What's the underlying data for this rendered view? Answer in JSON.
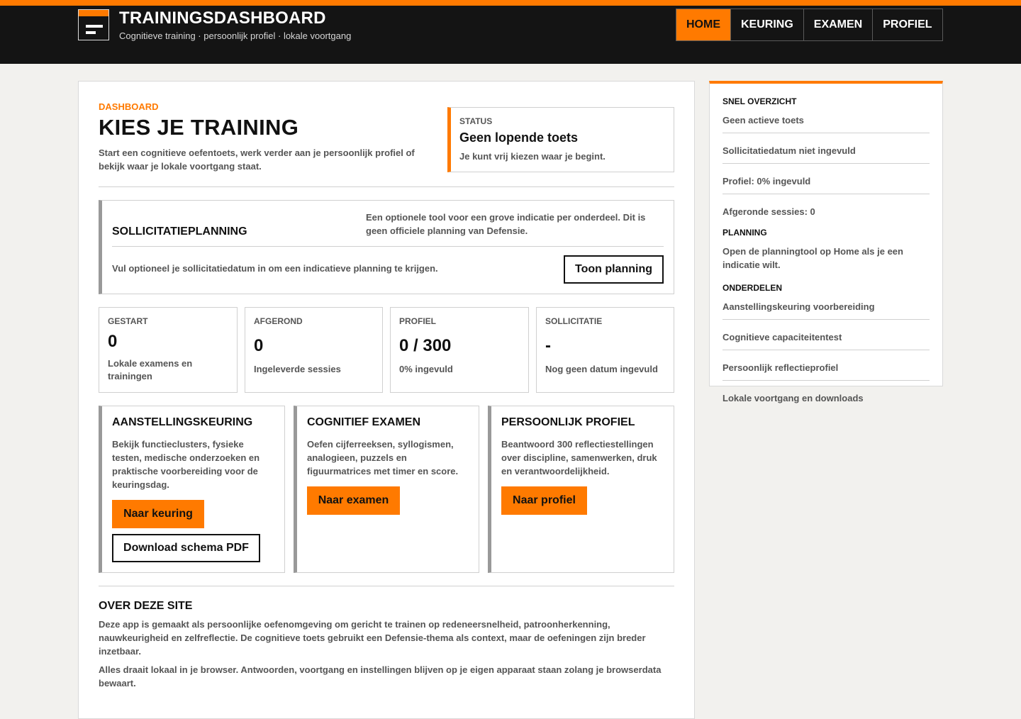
{
  "brand": {
    "title": "TRAININGSDASHBOARD",
    "subtitle": "Cognitieve training · persoonlijk profiel · lokale voortgang"
  },
  "nav": {
    "items": [
      {
        "label": "HOME",
        "active": true
      },
      {
        "label": "KEURING",
        "active": false
      },
      {
        "label": "EXAMEN",
        "active": false
      },
      {
        "label": "PROFIEL",
        "active": false
      }
    ]
  },
  "hero": {
    "kicker": "DASHBOARD",
    "title": "KIES JE TRAINING",
    "intro": "Start een cognitieve oefentoets, werk verder aan je persoonlijk profiel of bekijk waar je lokale voortgang staat."
  },
  "status": {
    "label": "STATUS",
    "title": "Geen lopende toets",
    "text": "Je kunt vrij kiezen waar je begint."
  },
  "planning": {
    "title": "SOLLICITATIEPLANNING",
    "description": "Een optionele tool voor een grove indicatie per onderdeel. Dit is geen officiele planning van Defensie.",
    "text": "Vul optioneel je sollicitatiedatum in om een indicatieve planning te krijgen.",
    "button": "Toon planning"
  },
  "stats": [
    {
      "label": "GESTART",
      "value": "0",
      "desc": "Lokale examens en trainingen"
    },
    {
      "label": "AFGEROND",
      "value": "0",
      "desc": "Ingeleverde sessies"
    },
    {
      "label": "PROFIEL",
      "value": "0 / 300",
      "desc": "0% ingevuld"
    },
    {
      "label": "SOLLICITATIE",
      "value": "-",
      "desc": "Nog geen datum ingevuld"
    }
  ],
  "cards": [
    {
      "title": "AANSTELLINGSKEURING",
      "text": "Bekijk functieclusters, fysieke testen, medische onderzoeken en praktische voorbereiding voor de keuringsdag.",
      "button": "Naar keuring",
      "secondary": "Download schema PDF"
    },
    {
      "title": "COGNITIEF EXAMEN",
      "text": "Oefen cijferreeksen, syllogismen, analogieen, puzzels en figuurmatrices met timer en score.",
      "button": "Naar examen"
    },
    {
      "title": "PERSOONLIJK PROFIEL",
      "text": "Beantwoord 300 reflectiestellingen over discipline, samenwerken, druk en verantwoordelijkheid.",
      "button": "Naar profiel"
    }
  ],
  "about": {
    "title": "OVER DEZE SITE",
    "p1": "Deze app is gemaakt als persoonlijke oefenomgeving om gericht te trainen op redeneersnelheid, patroonherkenning, nauwkeurigheid en zelfreflectie. De cognitieve toets gebruikt een Defensie-thema als context, maar de oefeningen zijn breder inzetbaar.",
    "p2": "Alles draait lokaal in je browser. Antwoorden, voortgang en instellingen blijven op je eigen apparaat staan zolang je browserdata bewaart."
  },
  "sidebar": {
    "overview_title": "SNEL OVERZICHT",
    "overview": [
      "Geen actieve toets",
      "Sollicitatiedatum niet ingevuld",
      "Profiel: 0% ingevuld",
      "Afgeronde sessies: 0"
    ],
    "planning_title": "PLANNING",
    "planning_text": "Open de planningtool op Home als je een indicatie wilt.",
    "parts_title": "ONDERDELEN",
    "parts": [
      "Aanstellingskeuring voorbereiding",
      "Cognitieve capaciteitentest",
      "Persoonlijk reflectieprofiel",
      "Lokale voortgang en downloads"
    ]
  },
  "colors": {
    "accent": "#ff7a00",
    "header_bg": "#141414",
    "page_bg": "#f2f1ee"
  }
}
